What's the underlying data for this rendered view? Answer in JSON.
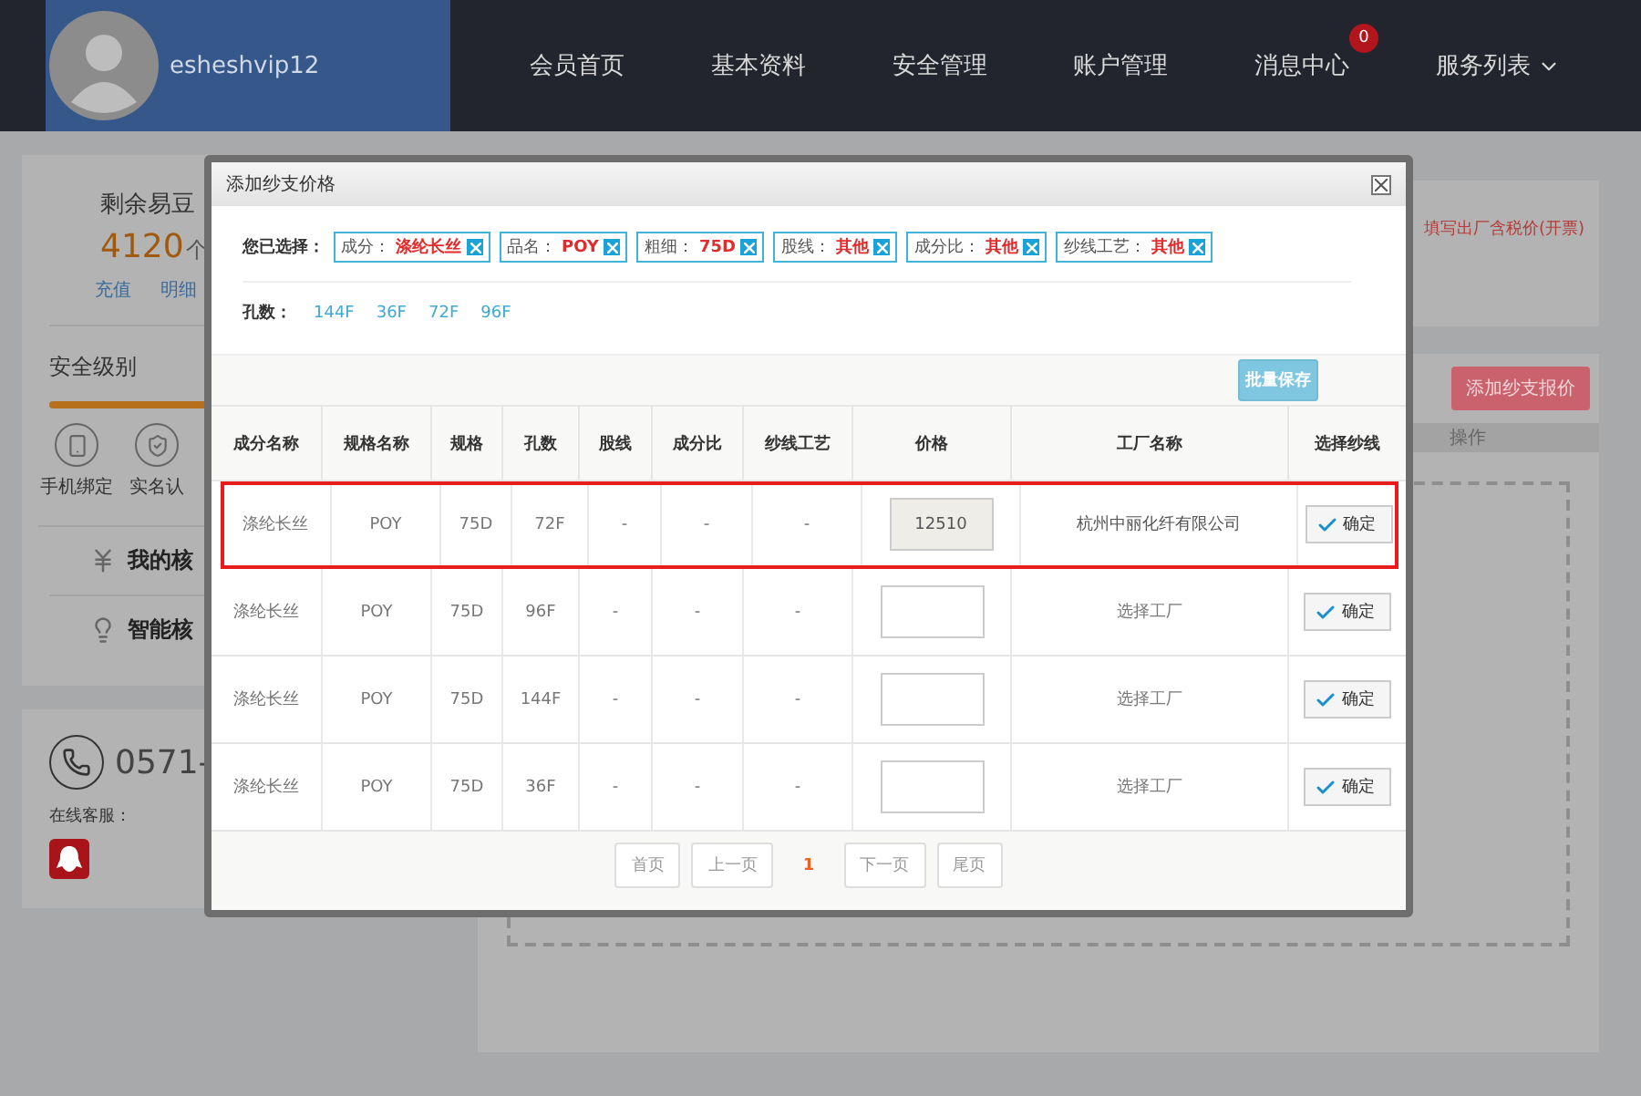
{
  "header": {
    "user": {
      "name": "esheshvip12"
    },
    "nav": [
      {
        "label": "会员首页",
        "dropdown": false
      },
      {
        "label": "基本资料",
        "dropdown": false
      },
      {
        "label": "安全管理",
        "dropdown": false
      },
      {
        "label": "账户管理",
        "dropdown": false
      },
      {
        "label": "消息中心",
        "badge": "0",
        "dropdown": false
      },
      {
        "label": "服务列表",
        "dropdown": true
      }
    ]
  },
  "sidebar": {
    "balance": {
      "label": "剩余易豆",
      "amount": "4120",
      "unit": "个",
      "links": [
        "充值",
        "明细"
      ]
    },
    "security": {
      "title": "安全级别",
      "items": [
        {
          "kind": "phone",
          "label": "手机绑定"
        },
        {
          "kind": "identity",
          "label": "实名认"
        }
      ]
    },
    "menu": [
      {
        "kind": "money",
        "label": "我的核"
      },
      {
        "kind": "idea",
        "label": "智能核"
      }
    ],
    "contact": {
      "phone": "0571-",
      "service_label": "在线客服："
    }
  },
  "main": {
    "notice": "填写出厂含税价(开票)",
    "add_button": "添加纱支报价",
    "columns": [
      "操作"
    ]
  },
  "modal": {
    "title": "添加纱支价格",
    "selected_label": "您已选择：",
    "filters": [
      {
        "name": "成分：",
        "value": "涤纶长丝"
      },
      {
        "name": "品名：",
        "value": "POY"
      },
      {
        "name": "粗细：",
        "value": "75D"
      },
      {
        "name": "股线：",
        "value": "其他"
      },
      {
        "name": "成分比：",
        "value": "其他"
      },
      {
        "name": "纱线工艺：",
        "value": "其他"
      }
    ],
    "holes_label": "孔数：",
    "hole_options": [
      "144F",
      "36F",
      "72F",
      "96F"
    ],
    "save_button": "批量保存",
    "columns": [
      "成分名称",
      "规格名称",
      "规格",
      "孔数",
      "股线",
      "成分比",
      "纱线工艺",
      "价格",
      "工厂名称",
      "选择纱线"
    ],
    "rows": [
      {
        "selected": true,
        "cells": [
          "涤纶长丝",
          "POY",
          "75D",
          "72F",
          "-",
          "-",
          "-"
        ],
        "price": "12510",
        "price_locked": true,
        "factory": "杭州中丽化纤有限公司",
        "confirm": "确定"
      },
      {
        "selected": false,
        "cells": [
          "涤纶长丝",
          "POY",
          "75D",
          "96F",
          "-",
          "-",
          "-"
        ],
        "price_locked": false,
        "factory": "选择工厂",
        "confirm": "确定"
      },
      {
        "selected": false,
        "cells": [
          "涤纶长丝",
          "POY",
          "75D",
          "144F",
          "-",
          "-",
          "-"
        ],
        "price_locked": false,
        "factory": "选择工厂",
        "confirm": "确定"
      },
      {
        "selected": false,
        "cells": [
          "涤纶长丝",
          "POY",
          "75D",
          "36F",
          "-",
          "-",
          "-"
        ],
        "price_locked": false,
        "factory": "选择工厂",
        "confirm": "确定"
      }
    ],
    "pagination": [
      {
        "kind": "button",
        "label": "首页"
      },
      {
        "kind": "button",
        "label": "上一页"
      },
      {
        "kind": "current",
        "label": "1"
      },
      {
        "kind": "button",
        "label": "下一页"
      },
      {
        "kind": "button",
        "label": "尾页"
      }
    ]
  }
}
